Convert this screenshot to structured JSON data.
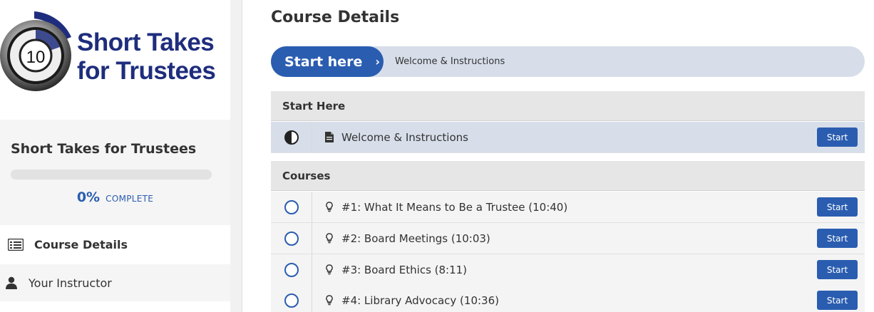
{
  "brand": {
    "logo_line1": "Short Takes",
    "logo_line2": "for Trustees",
    "timer_number": "10",
    "logo_color": "#1e2d7d"
  },
  "sidebar": {
    "course_title": "Short Takes for Trustees",
    "progress_percent": "0%",
    "progress_fraction": 0,
    "progress_word": "COMPLETE",
    "nav": [
      {
        "label": "Course Details",
        "icon": "list-icon",
        "active": true
      },
      {
        "label": "Your Instructor",
        "icon": "user-icon",
        "active": false
      }
    ]
  },
  "main": {
    "page_title": "Course Details",
    "start_bar": {
      "button_label": "Start here",
      "chevron": "›",
      "lesson": "Welcome & Instructions"
    },
    "sections": [
      {
        "title": "Start Here",
        "lessons": [
          {
            "title": "Welcome & Instructions",
            "status": "in-progress",
            "type_icon": "document-icon",
            "button": "Start"
          }
        ]
      },
      {
        "title": "Courses",
        "lessons": [
          {
            "title": "#1: What It Means to Be a Trustee (10:40)",
            "status": "not-started",
            "type_icon": "lightbulb-icon",
            "button": "Start"
          },
          {
            "title": "#2: Board Meetings (10:03)",
            "status": "not-started",
            "type_icon": "lightbulb-icon",
            "button": "Start"
          },
          {
            "title": "#3: Board Ethics (8:11)",
            "status": "not-started",
            "type_icon": "lightbulb-icon",
            "button": "Start"
          },
          {
            "title": "#4: Library Advocacy (10:36)",
            "status": "not-started",
            "type_icon": "lightbulb-icon",
            "button": "Start"
          }
        ]
      }
    ]
  },
  "colors": {
    "accent": "#2a5db0",
    "highlight_row": "#d7deea"
  }
}
